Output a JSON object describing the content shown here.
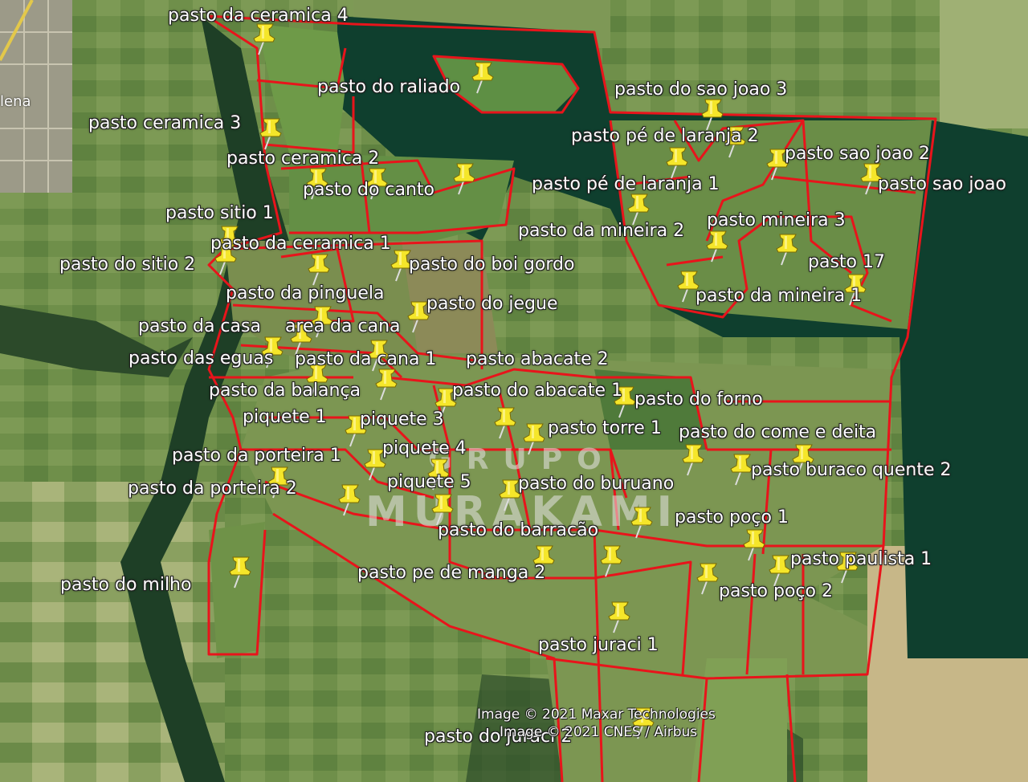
{
  "map": {
    "credits": [
      "Image © 2021 Maxar Technologies",
      "Image © 2021 CNES / Airbus"
    ],
    "town_label": "lena",
    "watermark": {
      "line1": "GRUPO",
      "line2": "MURAKAMI"
    },
    "colors": {
      "boundary": "#e8141b",
      "pin": "#f5e62a",
      "forest": "#0f3f2e",
      "pasture": "#5d8a3c"
    },
    "labels": [
      "pasto da ceramica 4",
      "pasto do raliado",
      "pasto do sao joao 3",
      "pasto ceramica 3",
      "pasto pé de laranja 2",
      "pasto sao joao 2",
      "pasto ceramica 2",
      "pasto do canto",
      "pasto pé de laranja 1",
      "pasto sao joao",
      "pasto sitio 1",
      "pasto mineira 3",
      "pasto da mineira 2",
      "pasto da ceramica 1",
      "pasto 17",
      "pasto do sitio 2",
      "pasto do boi gordo",
      "pasto da pinguela",
      "pasto da mineira 1",
      "pasto do jegue",
      "pasto da casa",
      "area da cana",
      "pasto das eguas",
      "pasto da cana 1",
      "pasto abacate 2",
      "pasto da balança",
      "pasto do abacate 1",
      "pasto do forno",
      "piquete 1",
      "piquete 3",
      "pasto torre 1",
      "pasto do come e deita",
      "pasto da porteira 1",
      "piquete 4",
      "pasto buraco quente 2",
      "pasto da porteira 2",
      "piquete 5",
      "pasto do buruano",
      "pasto  poço 1",
      "pasto do barracão",
      "pasto paulista 1",
      "pasto do milho",
      "pasto pe de manga 2",
      "pasto poço 2",
      "pasto juraci 1",
      "pasto do juraci 2"
    ]
  }
}
